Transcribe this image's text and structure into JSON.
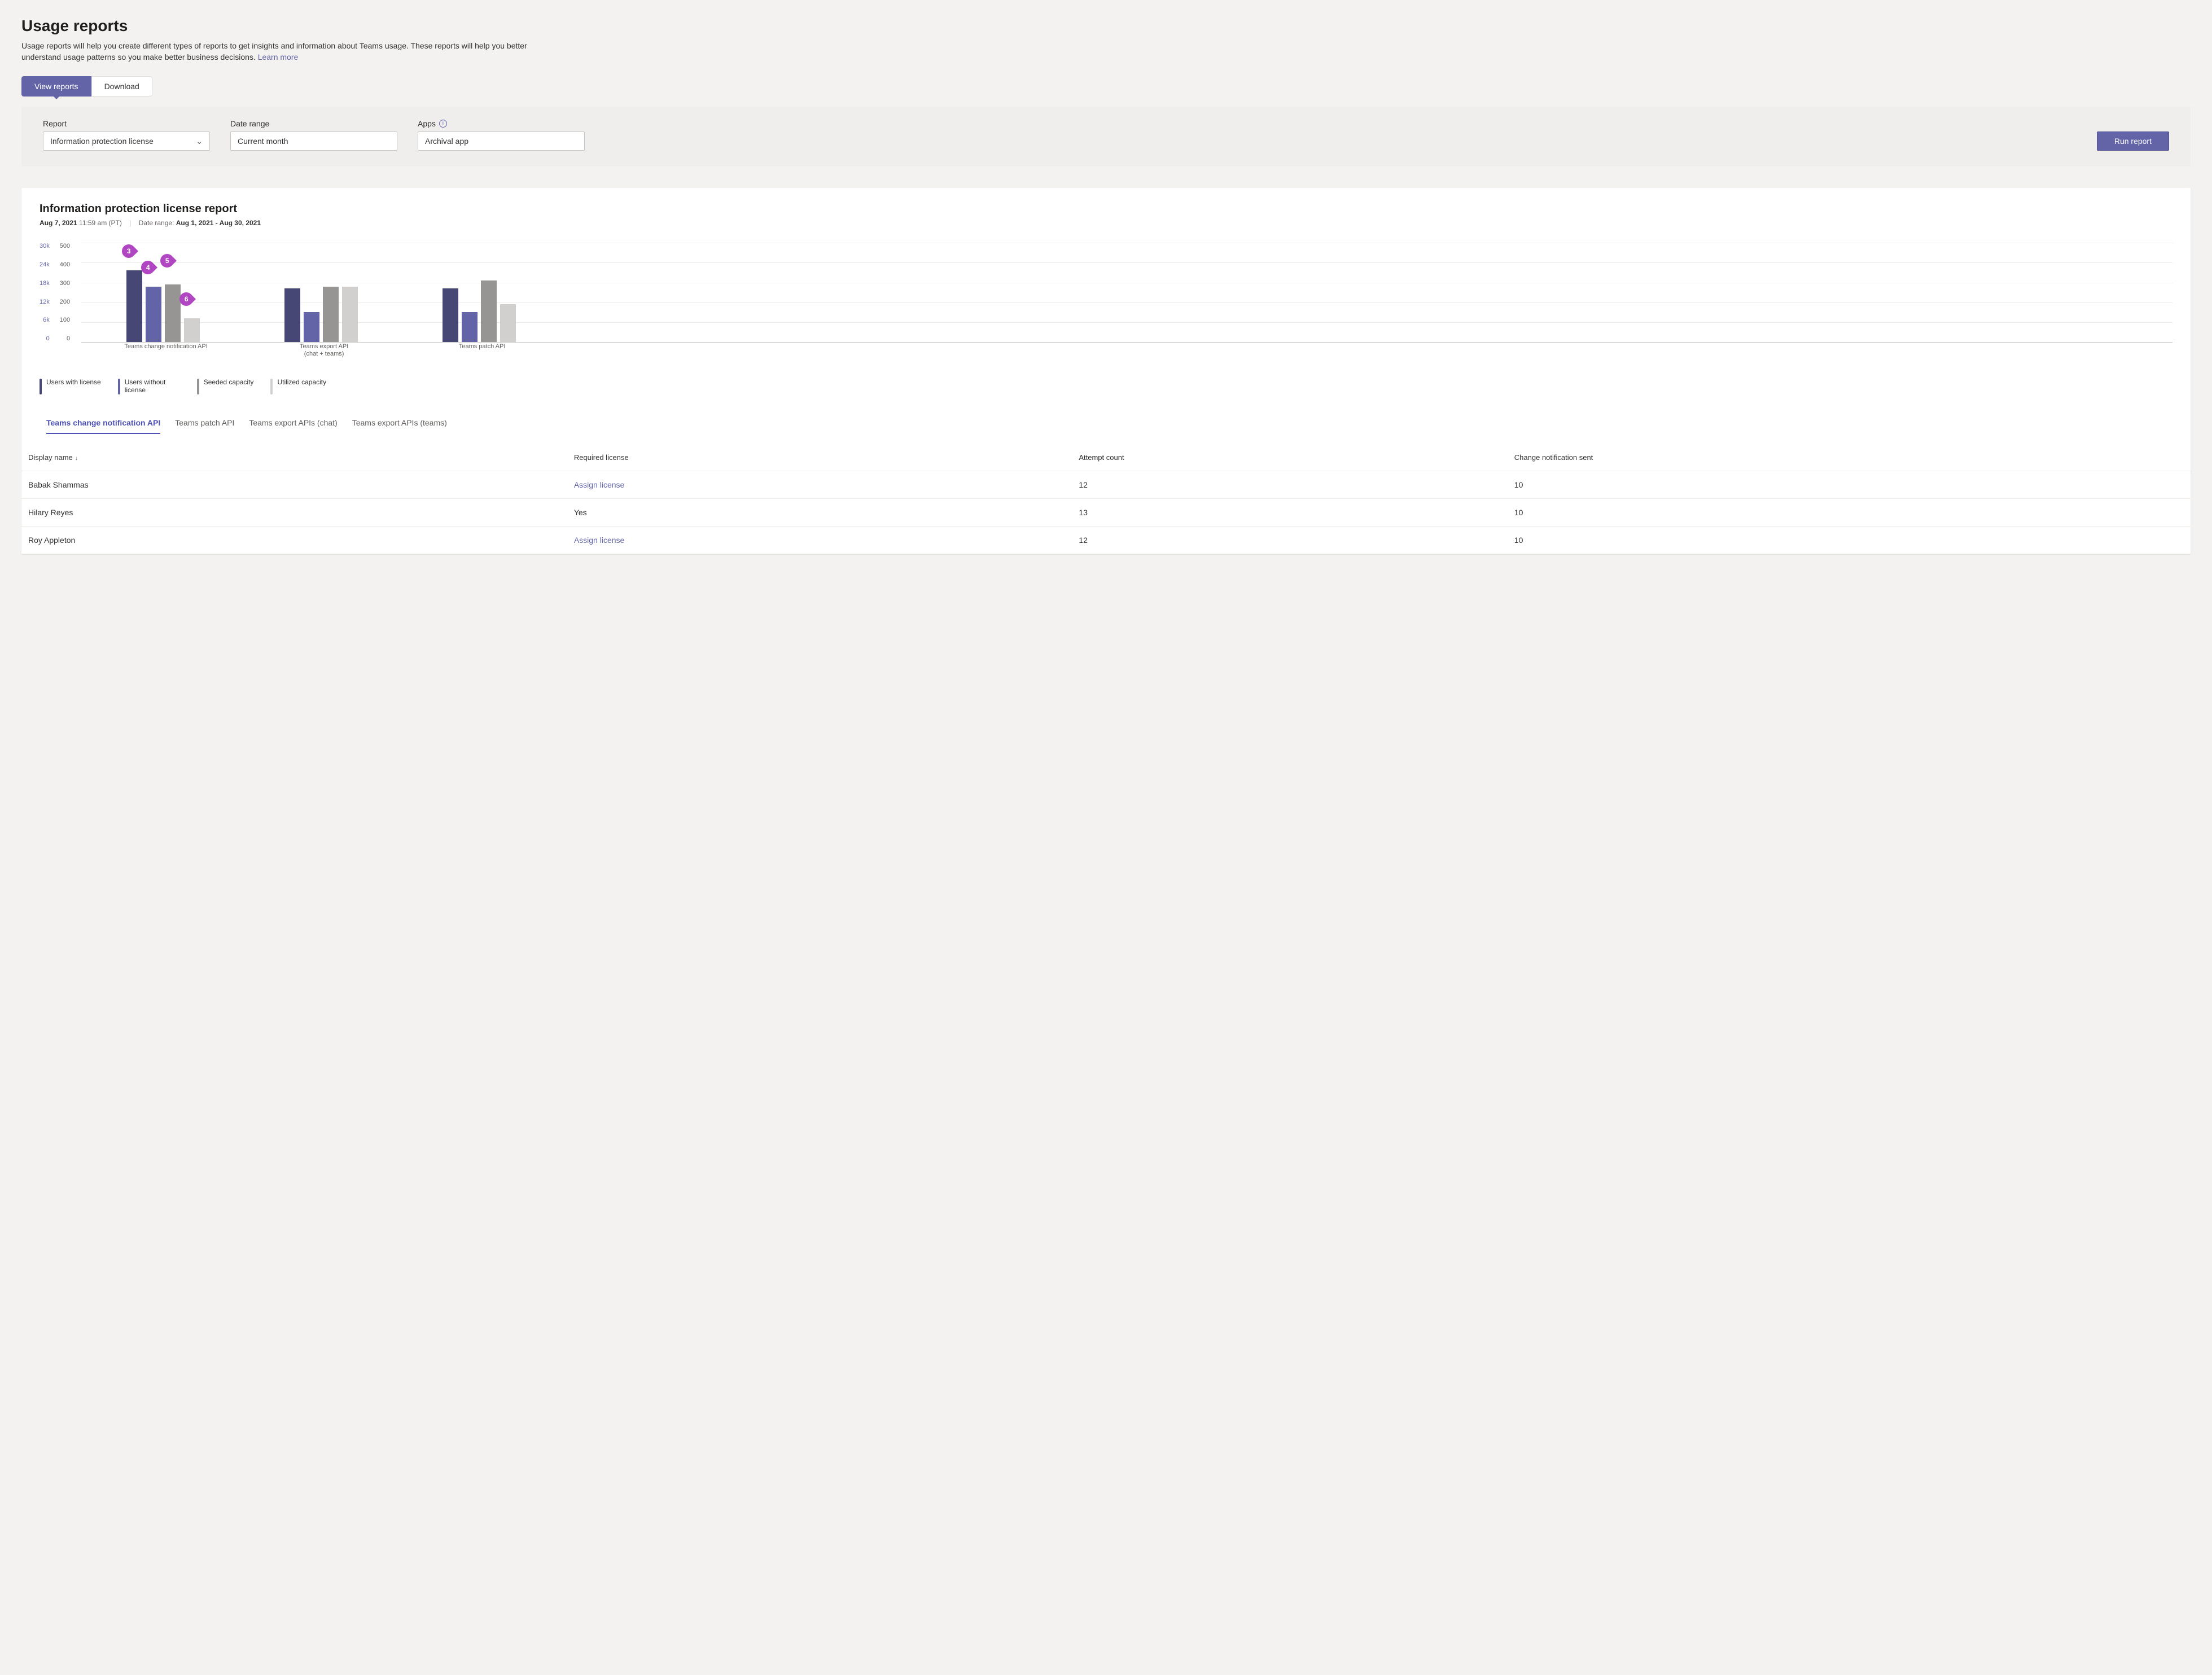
{
  "header": {
    "title": "Usage reports",
    "subtitle_pre": "Usage reports will help you create different types of reports to get insights and information about Teams usage. These reports will help you better understand usage patterns so you make better business decisions. ",
    "learn_more": "Learn more"
  },
  "view_tabs": {
    "view_reports": "View reports",
    "download": "Download"
  },
  "filters": {
    "report_label": "Report",
    "report_value": "Information protection license",
    "date_label": "Date range",
    "date_value": "Current month",
    "apps_label": "Apps",
    "apps_value": "Archival app",
    "run_label": "Run report"
  },
  "report": {
    "title": "Information protection license report",
    "asof_date": "Aug 7, 2021",
    "asof_time": "11:59 am (PT)",
    "range_label": "Date range:",
    "range_value": "Aug 1, 2021 - Aug 30, 2021"
  },
  "chart_data": {
    "type": "bar",
    "y_axis_left": {
      "ticks": [
        "30k",
        "24k",
        "18k",
        "12k",
        "6k",
        "0"
      ],
      "max": 30
    },
    "y_axis_right": {
      "ticks": [
        "500",
        "400",
        "300",
        "200",
        "100",
        "0"
      ],
      "max": 500
    },
    "categories": [
      "Teams change notification API",
      "Teams export API\n(chat + teams)",
      "Teams patch API"
    ],
    "series": [
      {
        "name": "Users with license",
        "color": "#464775",
        "values": [
          360,
          270,
          270
        ]
      },
      {
        "name": "Users without license",
        "color": "#6264a7",
        "values": [
          280,
          150,
          150
        ]
      },
      {
        "name": "Seeded capacity",
        "color": "#979593",
        "values": [
          290,
          280,
          310
        ]
      },
      {
        "name": "Utilized capacity",
        "color": "#d2d0ce",
        "values": [
          120,
          280,
          190
        ]
      }
    ],
    "scale_max": 500,
    "annotations": [
      {
        "n": "3",
        "cluster": 0,
        "bar": 0,
        "yoff": -22
      },
      {
        "n": "4",
        "cluster": 0,
        "bar": 1,
        "yoff": -22
      },
      {
        "n": "5",
        "cluster": 0,
        "bar": 2,
        "yoff": -30
      },
      {
        "n": "6",
        "cluster": 0,
        "bar": 3,
        "yoff": -22
      }
    ]
  },
  "sub_tabs": [
    "Teams change notification API",
    "Teams patch API",
    "Teams export APIs (chat)",
    "Teams export APIs (teams)"
  ],
  "table": {
    "columns": [
      "Display name",
      "Required license",
      "Attempt count",
      "Change notification sent"
    ],
    "rows": [
      {
        "name": "Babak Shammas",
        "license": "Assign license",
        "license_is_link": true,
        "attempt": "12",
        "sent": "10"
      },
      {
        "name": "Hilary Reyes",
        "license": "Yes",
        "license_is_link": false,
        "attempt": "13",
        "sent": "10"
      },
      {
        "name": "Roy Appleton",
        "license": "Assign license",
        "license_is_link": true,
        "attempt": "12",
        "sent": "10"
      }
    ]
  }
}
